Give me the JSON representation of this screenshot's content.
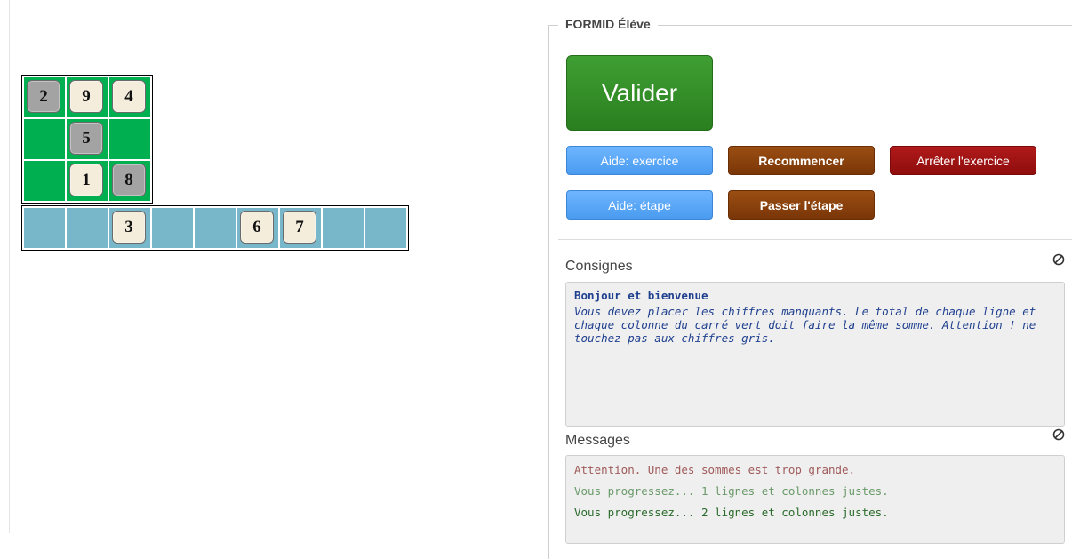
{
  "board": {
    "square": [
      {
        "value": "2",
        "kind": "fixed"
      },
      {
        "value": "9",
        "kind": "movable"
      },
      {
        "value": "4",
        "kind": "movable"
      },
      {
        "value": "",
        "kind": "empty"
      },
      {
        "value": "5",
        "kind": "fixed"
      },
      {
        "value": "",
        "kind": "empty"
      },
      {
        "value": "",
        "kind": "empty"
      },
      {
        "value": "1",
        "kind": "movable"
      },
      {
        "value": "8",
        "kind": "fixed"
      }
    ],
    "bank": [
      {
        "value": "",
        "kind": "empty"
      },
      {
        "value": "",
        "kind": "empty"
      },
      {
        "value": "3",
        "kind": "movable"
      },
      {
        "value": "",
        "kind": "empty"
      },
      {
        "value": "",
        "kind": "empty"
      },
      {
        "value": "6",
        "kind": "movable"
      },
      {
        "value": "7",
        "kind": "movable"
      },
      {
        "value": "",
        "kind": "empty"
      },
      {
        "value": "",
        "kind": "empty"
      }
    ]
  },
  "panel": {
    "legend": "FORMID Élève",
    "validate_label": "Valider",
    "buttons": {
      "help_exercise": "Aide: exercice",
      "restart": "Recommencer",
      "stop_exercise": "Arrêter l'exercice",
      "help_step": "Aide: étape",
      "skip_step": "Passer l'étape"
    },
    "instructions": {
      "label": "Consignes",
      "heading": "Bonjour et bienvenue",
      "body": "Vous devez placer les chiffres manquants. Le total de chaque ligne et chaque colonne du carré vert doit faire la même somme. Attention ! ne touchez pas aux chiffres gris."
    },
    "messages": {
      "label": "Messages",
      "items": [
        {
          "text": "Attention. Une des sommes est trop grande.",
          "color": "#a05a5a"
        },
        {
          "text": "Vous progressez... 1 lignes et colonnes justes.",
          "color": "#6a9a6a"
        },
        {
          "text": "Vous progressez... 2 lignes et colonnes justes.",
          "color": "#2a6a2a"
        }
      ]
    }
  }
}
